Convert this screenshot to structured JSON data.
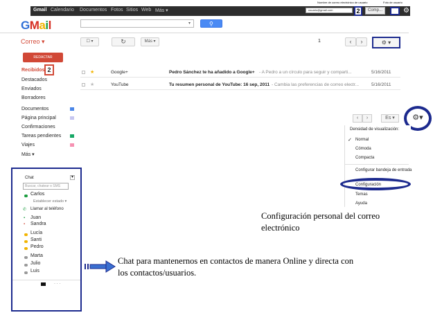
{
  "colors": {
    "accent_blue": "#1c2a8e",
    "gmail_red": "#d14836",
    "search_blue": "#4a8af4",
    "top_bar": "#2d2d2d"
  },
  "topbar": {
    "links": [
      "Gmail",
      "Calendario",
      "Documentos",
      "Fotos",
      "Sitios",
      "Web",
      "Más ▾"
    ],
    "note_email": "Nombre de correo electrónico de usuario",
    "note_config": "Foto de usuario",
    "email_field": "usuario@gmail.com",
    "number_badge": "2",
    "config_label": "Comp...",
    "gear_icon": "gear-icon"
  },
  "header": {
    "logo_letters": [
      "G",
      "M",
      "a",
      "i",
      "l"
    ],
    "search_placeholder": "",
    "search_button_icon": "search-icon"
  },
  "toolbar": {
    "correo_label": "Correo ▾",
    "select_label": "☐ ▾",
    "refresh_icon": "↻",
    "more_label": "Más ▾",
    "page_number": "1",
    "prev_icon": "‹",
    "next_icon": "›",
    "settings_label": "⚙ ▾"
  },
  "sidebar": {
    "compose_label": "REDACTAR",
    "inbox_label": "Recibidos",
    "inbox_count": "2",
    "items": [
      "Destacados",
      "Enviados",
      "Borradores",
      "Documentos",
      "Página principal",
      "Confirmaciones",
      "Tareas pendientes",
      "Viajes",
      "Más ▾"
    ],
    "label_colors": [
      "#4a86e8",
      "#c6c6f0",
      "#16a765",
      "#f691b2"
    ]
  },
  "mails": [
    {
      "sender": "Google+",
      "subject": "Pedro Sánchez te ha añadido a Google+",
      "snippet": "- A Pedro a un círculo para seguir y comparti...",
      "date": "5/16/2011"
    },
    {
      "sender": "YouTube",
      "subject": "Tu resumen personal de YouTube: 16 sep, 2011",
      "snippet": "- Cambia las preferencias de correo electr...",
      "date": "5/16/2011"
    }
  ],
  "settings_menu": {
    "prev_icon": "‹",
    "next_icon": "›",
    "lang_label": "Es ▾",
    "gear_label": "⚙▾",
    "density_label": "Densidad de visualización:",
    "check_mark": "✓",
    "density_options": [
      "Normal",
      "Cómoda",
      "Compacta"
    ],
    "items": [
      "Configurar bandeja de entrada",
      "Configuración",
      "Temas",
      "Ayuda"
    ]
  },
  "chat": {
    "title": "Chat",
    "search_placeholder": "Buscar, chatear o SMS",
    "contacts": [
      {
        "name": "Carlos",
        "status_color": "#1a9c3e"
      },
      {
        "name": "Establecer estado ▾",
        "status_color": ""
      },
      {
        "name": "Llamar al teléfono",
        "status_color": "#1a9c3e"
      },
      {
        "name": "Juan",
        "status_color": "#1a9c3e"
      },
      {
        "name": "Sandra",
        "status_color": "#d14836"
      },
      {
        "name": "Lucía",
        "status_color": "#f2b400"
      },
      {
        "name": "Santi",
        "status_color": "#f2b400"
      },
      {
        "name": "Pedro",
        "status_color": "#f2b400"
      },
      {
        "name": "Marta",
        "status_color": "#999999"
      },
      {
        "name": "Julio",
        "status_color": "#999999"
      },
      {
        "name": "Luis",
        "status_color": "#999999"
      }
    ],
    "more_label": "· · ·",
    "dropdown_icon": "▾"
  },
  "annotations": {
    "config_note": "Configuración personal del correo electrónico",
    "chat_note": "Chat para mantenernos en contactos de manera Online y directa con los contactos/usuarios."
  }
}
